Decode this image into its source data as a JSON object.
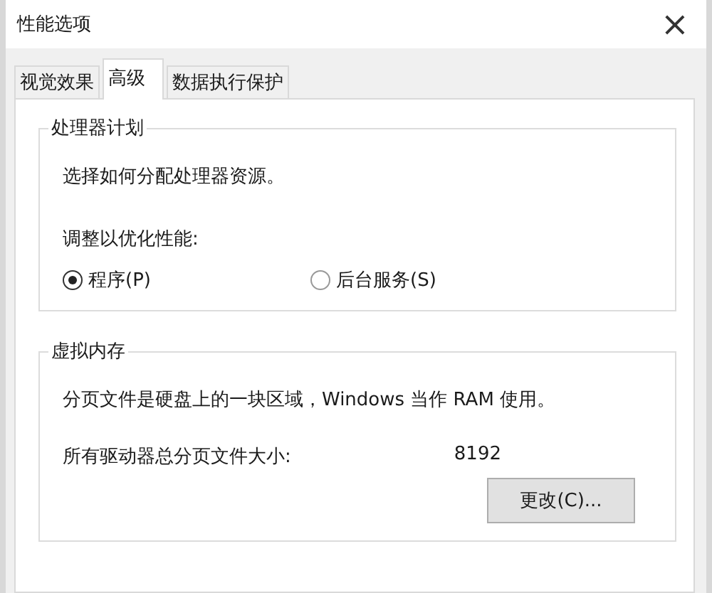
{
  "window": {
    "title": "性能选项",
    "close": "×"
  },
  "tabs": [
    {
      "label": "视觉效果",
      "selected": false
    },
    {
      "label": "高级",
      "selected": true
    },
    {
      "label": "数据执行保护",
      "selected": false
    }
  ],
  "processor_scheduling": {
    "title": "处理器计划",
    "description": "选择如何分配处理器资源。",
    "prompt": "调整以优化性能:",
    "options": [
      {
        "label": "程序(P)",
        "selected": true
      },
      {
        "label": "后台服务(S)",
        "selected": false
      }
    ]
  },
  "virtual_memory": {
    "title": "虚拟内存",
    "description": "分页文件是硬盘上的一块区域，Windows 当作 RAM 使用。",
    "total_label": "所有驱动器总分页文件大小:",
    "total_value": "8192",
    "button": "更改(C)..."
  }
}
